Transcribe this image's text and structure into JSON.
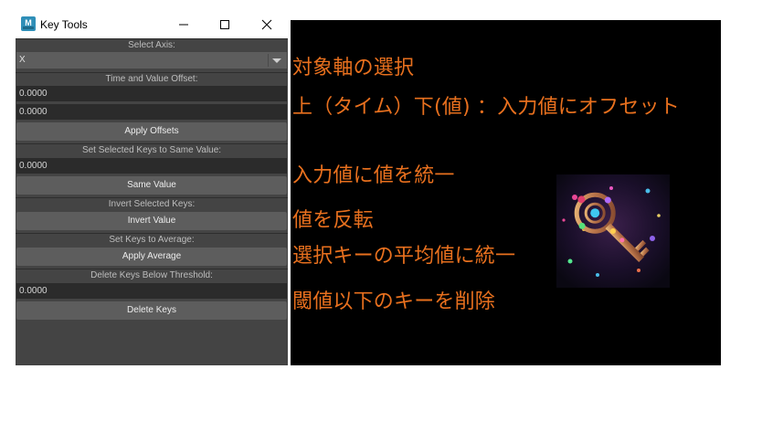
{
  "window": {
    "title": "Key Tools",
    "icon_letter": "M",
    "controls": [
      "minimize-icon",
      "maximize-icon",
      "close-icon"
    ]
  },
  "axis": {
    "label": "Select Axis:",
    "selected": "X"
  },
  "offset": {
    "label": "Time and Value Offset:",
    "time_value": "0.0000",
    "value_value": "0.0000",
    "button": "Apply Offsets"
  },
  "same_value": {
    "label": "Set Selected Keys to Same Value:",
    "value": "0.0000",
    "button": "Same Value"
  },
  "invert": {
    "label": "Invert Selected Keys:",
    "button": "Invert Value"
  },
  "average": {
    "label": "Set Keys to Average:",
    "button": "Apply Average"
  },
  "threshold": {
    "label": "Delete Keys Below Threshold:",
    "value": "0.0000",
    "button": "Delete Keys"
  },
  "annotations": {
    "axis": "対象軸の選択",
    "offset": "上（タイム）下(値) ：入力値にオフセット",
    "same_value": "入力値に値を統一",
    "invert": "値を反転",
    "average": "選択キーの平均値に統一",
    "threshold": "閾値以下のキーを削除"
  },
  "colors": {
    "annotation_text": "#e8701e",
    "panel_bg": "#000000",
    "window_bg": "#444444"
  }
}
